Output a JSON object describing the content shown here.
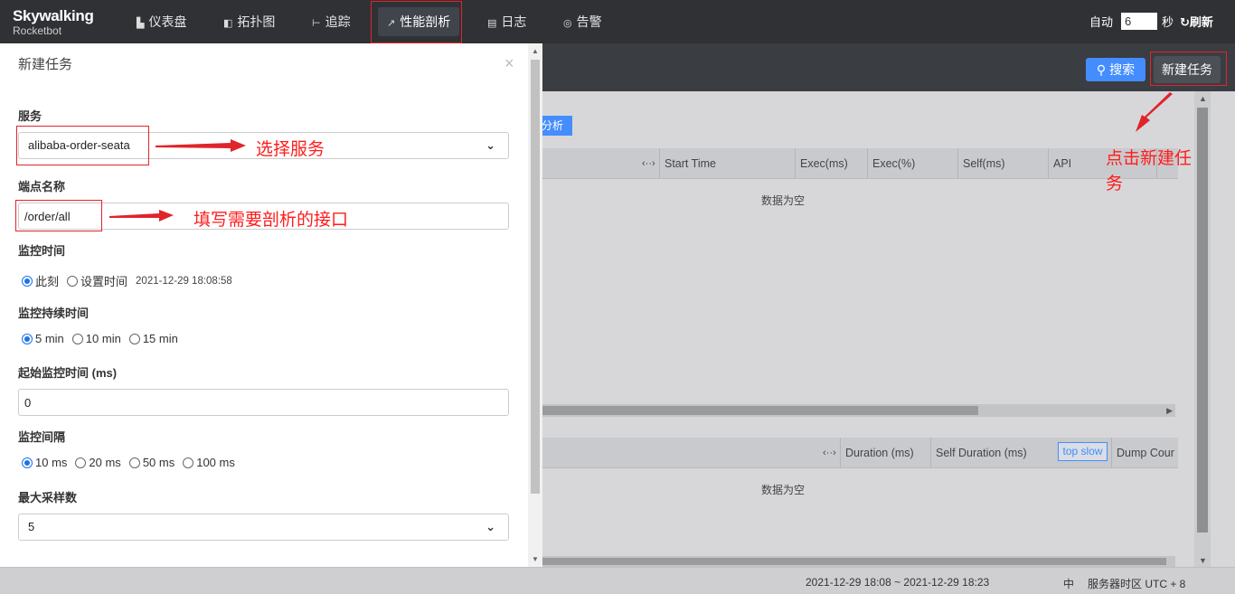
{
  "logo": {
    "brand": "Skywalking",
    "product": "Rocketbot"
  },
  "nav": {
    "items": [
      {
        "label": "仪表盘",
        "icon": "bar-chart-icon",
        "glyph": "▙"
      },
      {
        "label": "拓扑图",
        "icon": "topology-icon",
        "glyph": "◧"
      },
      {
        "label": "追踪",
        "icon": "trace-icon",
        "glyph": "⊢"
      },
      {
        "label": "性能剖析",
        "icon": "line-chart-icon",
        "glyph": "↗"
      },
      {
        "label": "日志",
        "icon": "log-icon",
        "glyph": "▤"
      },
      {
        "label": "告警",
        "icon": "alarm-icon",
        "glyph": "◎"
      }
    ],
    "active": "性能剖析"
  },
  "auto_refresh": {
    "auto_label": "自动",
    "interval": "6",
    "unit": "秒",
    "refresh_label": "刷新",
    "refresh_glyph": "↻"
  },
  "toolbar": {
    "search_label": "搜索",
    "search_glyph": "⚲",
    "new_task_label": "新建任务"
  },
  "task_list": {
    "tab_label": "分析"
  },
  "segment_table": {
    "expand": "‹··›",
    "columns": [
      "Start Time",
      "Exec(ms)",
      "Exec(%)",
      "Self(ms)",
      "API"
    ],
    "empty_text": "数据为空"
  },
  "stack_table": {
    "expand": "‹··›",
    "columns": [
      "Duration (ms)",
      "Self Duration (ms)"
    ],
    "top_slow_label": "top slow",
    "dump_column": "Dump Cour",
    "empty_text": "数据为空"
  },
  "dialog": {
    "title": "新建任务",
    "close_glyph": "×",
    "service_label": "服务",
    "service_value": "alibaba-order-seata",
    "endpoint_label": "端点名称",
    "endpoint_value": "/order/all",
    "monitor_time_label": "监控时间",
    "monitor_time_options": [
      {
        "label": "此刻",
        "checked": true
      },
      {
        "label": "设置时间",
        "checked": false
      }
    ],
    "monitor_time_value": "2021-12-29 18:08:58",
    "duration_label": "监控持续时间",
    "duration_options": [
      {
        "label": "5 min",
        "checked": true
      },
      {
        "label": "10 min",
        "checked": false
      },
      {
        "label": "15 min",
        "checked": false
      }
    ],
    "start_delay_label": "起始监控时间 (ms)",
    "start_delay_value": "0",
    "interval_label": "监控间隔",
    "interval_options": [
      {
        "label": "10 ms",
        "checked": true
      },
      {
        "label": "20 ms",
        "checked": false
      },
      {
        "label": "50 ms",
        "checked": false
      },
      {
        "label": "100 ms",
        "checked": false
      }
    ],
    "max_samples_label": "最大采样数",
    "max_samples_value": "5",
    "chevron": "⌄"
  },
  "annotations": {
    "select_service": "选择服务",
    "fill_endpoint": "填写需要剖析的接口",
    "click_new_task_line1": "点击新建任",
    "click_new_task_line2": "务"
  },
  "footer": {
    "time_range": "2021-12-29 18:08 ~ 2021-12-29 18:23",
    "lang": "中",
    "timezone": "服务器时区 UTC + 8"
  },
  "colors": {
    "accent": "#448dfe",
    "annotation_red": "#e0242a",
    "topbar": "#2f3135"
  }
}
